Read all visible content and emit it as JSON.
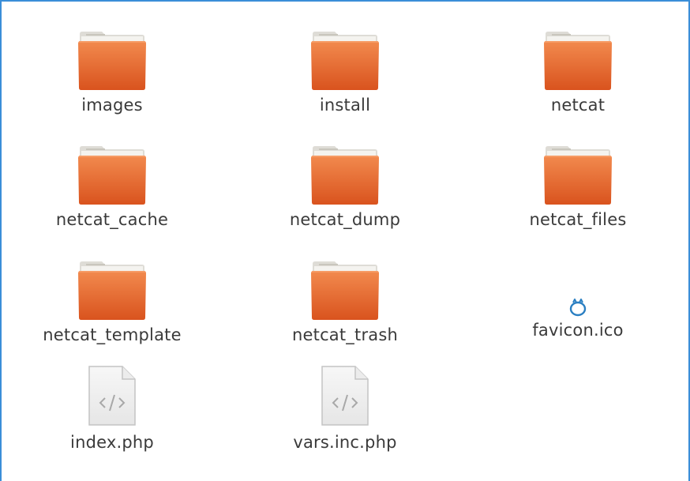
{
  "window": {
    "accent_color": "#3b8ed8"
  },
  "files": [
    {
      "name": "images",
      "type": "folder",
      "icon": "folder-icon"
    },
    {
      "name": "install",
      "type": "folder",
      "icon": "folder-icon"
    },
    {
      "name": "netcat",
      "type": "folder",
      "icon": "folder-icon"
    },
    {
      "name": "netcat_cache",
      "type": "folder",
      "icon": "folder-icon"
    },
    {
      "name": "netcat_dump",
      "type": "folder",
      "icon": "folder-icon"
    },
    {
      "name": "netcat_files",
      "type": "folder",
      "icon": "folder-icon"
    },
    {
      "name": "netcat_template",
      "type": "folder",
      "icon": "folder-icon"
    },
    {
      "name": "netcat_trash",
      "type": "folder",
      "icon": "folder-icon"
    },
    {
      "name": "favicon.ico",
      "type": "icon",
      "icon": "favicon-icon"
    },
    {
      "name": "index.php",
      "type": "php",
      "icon": "php-file-icon"
    },
    {
      "name": "vars.inc.php",
      "type": "php",
      "icon": "php-file-icon"
    }
  ]
}
